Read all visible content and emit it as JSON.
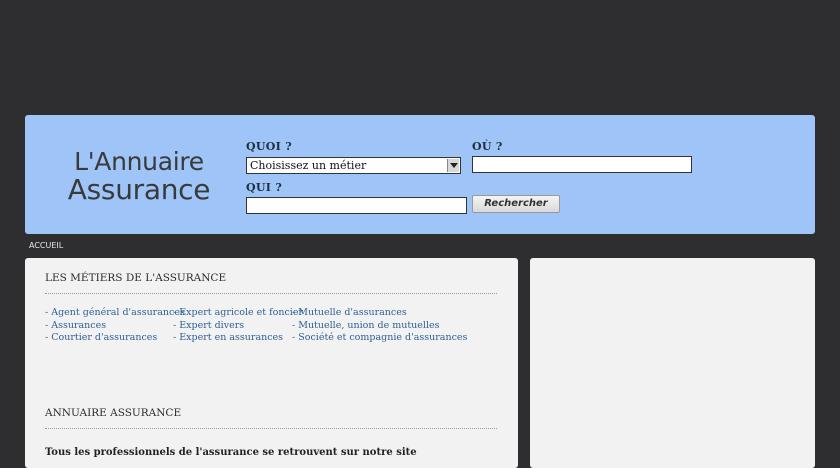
{
  "logo": {
    "line1": "L'Annuaire",
    "line2": "Assurance"
  },
  "search": {
    "quoi_label": "QUOI ?",
    "quoi_selected": "Choisissez un métier",
    "ou_label": "OÙ ?",
    "ou_value": "",
    "qui_label": "QUI ?",
    "qui_value": "",
    "button_label": "Rechercher"
  },
  "breadcrumb": {
    "home": "ACCUEIL"
  },
  "metiers": {
    "title": "LES MÉTIERS DE L'ASSURANCE",
    "col1": [
      "- Agent général d'assurances",
      "- Assurances",
      "- Courtier d'assurances"
    ],
    "col2": [
      "- Expert agricole et foncier",
      "- Expert divers",
      "- Expert en assurances"
    ],
    "col3": [
      "- Mutuelle d'assurances",
      "- Mutuelle, union de mutuelles",
      "- Société et compagnie d'assurances"
    ]
  },
  "annuaire": {
    "title": "ANNUAIRE ASSURANCE",
    "intro": "Tous les professionnels de l'assurance se retrouvent sur notre site"
  },
  "colors": {
    "background": "#2e2e30",
    "header": "#9fc5f8",
    "panel": "#f2f2f2",
    "link": "#2d5f96"
  }
}
